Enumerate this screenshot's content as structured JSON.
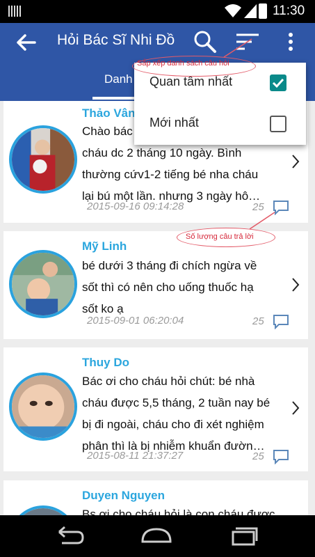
{
  "status_bar": {
    "time": "11:30"
  },
  "app_bar": {
    "title": "Hỏi Bác Sĩ Nhi Đồ",
    "tab_label": "Danh"
  },
  "sort_menu": {
    "options": [
      {
        "label": "Quan tâm nhất",
        "checked": true
      },
      {
        "label": "Mới nhất",
        "checked": false
      }
    ]
  },
  "annotations": {
    "sort_hint": "Sắp xếp danh sách câu hỏi",
    "count_hint": "Số lượng câu trả lời"
  },
  "questions": [
    {
      "name": "Thảo Vân",
      "text": "Chào bác sĩ, cháu dc 2 tháng 10 ngày. Bình thường cứv1-2 tiếng bé nha cháu lại bú một lần. nhưng 3 ngày hô…",
      "line1": "Chào bác",
      "line2": "cháu dc 2 tháng 10 ngày. Bình",
      "line3": "thường cứv1-2 tiếng bé nha cháu",
      "line4": "lại bú một lần. nhưng 3 ngày hô…",
      "timestamp": "2015-09-16 09:14:28",
      "answers": "25"
    },
    {
      "name": "Mỹ Linh",
      "line1": "bé dưới 3 tháng đi chích ngừa về",
      "line2": "sốt thì có nên cho uống thuốc hạ",
      "line3": "sốt ko ạ",
      "timestamp": "2015-09-01 06:20:04",
      "answers": "25"
    },
    {
      "name": "Thuy Do",
      "line1": "Bác ơi cho cháu hỏi chút: bé nhà",
      "line2": "cháu được 5,5 tháng, 2 tuần nay bé",
      "line3": "bị đi ngoài, cháu cho đi xét nghiệm",
      "line4": "phân thì là bị nhiễm khuẩn đườn…",
      "timestamp": "2015-08-11 21:37:27",
      "answers": "25"
    },
    {
      "name": "Duyen Nguyen",
      "line1": "Bs ơi cho cháu hỏi là con cháu được"
    }
  ],
  "colors": {
    "app_bar": "#2f56a6",
    "name": "#2ba6de",
    "avatar_ring": "#2aa2de",
    "checkbox_on": "#0a8a8a",
    "annotation": "#d6283a"
  }
}
